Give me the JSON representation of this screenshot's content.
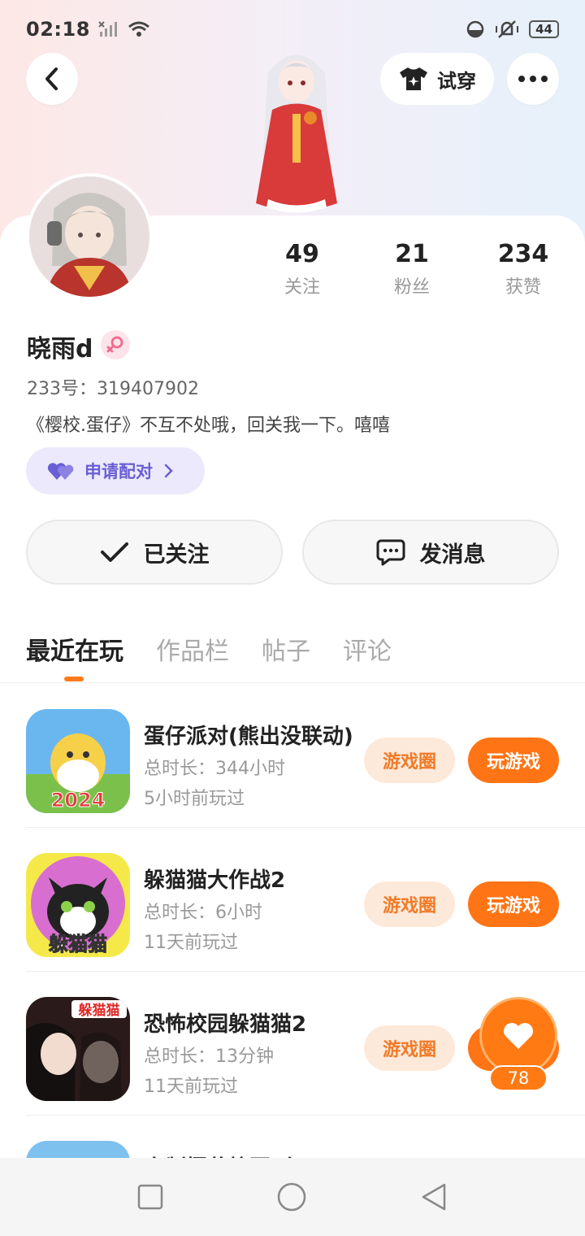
{
  "status_bar": {
    "time": "02:18",
    "battery": "44"
  },
  "header": {
    "try_on_label": "试穿"
  },
  "profile": {
    "stats": [
      {
        "value": "49",
        "label": "关注"
      },
      {
        "value": "21",
        "label": "粉丝"
      },
      {
        "value": "234",
        "label": "获赞"
      }
    ],
    "username": "晓雨d",
    "uid": "233号：319407902",
    "bio": "《樱校.蛋仔》不互不处哦，回关我一下。嘻嘻",
    "pair_label": "申请配对"
  },
  "actions": {
    "follow_label": "已关注",
    "message_label": "发消息"
  },
  "tabs": [
    "最近在玩",
    "作品栏",
    "帖子",
    "评论"
  ],
  "games": [
    {
      "name": "蛋仔派对(熊出没联动)",
      "duration": "总时长：344小时",
      "last_played": "5小时前玩过",
      "circle_label": "游戏圈",
      "play_label": "玩游戏",
      "icon_text": "2024"
    },
    {
      "name": "躲猫猫大作战2",
      "duration": "总时长：6小时",
      "last_played": "11天前玩过",
      "circle_label": "游戏圈",
      "play_label": "玩游戏",
      "icon_text": "躲猫猫"
    },
    {
      "name": "恐怖校园躲猫猫2",
      "duration": "总时长：13分钟",
      "last_played": "11天前玩过",
      "circle_label": "游戏圈",
      "play_label": "玩游戏",
      "icon_text": "躲猫猫"
    },
    {
      "name": "自制樱花校园（无"
    }
  ],
  "floating_like": {
    "count": "78"
  },
  "colors": {
    "accent": "#ff7414",
    "accent_light": "#fde9da",
    "pair_bg": "#ebe9fb",
    "pair_text": "#6a5ed4"
  }
}
